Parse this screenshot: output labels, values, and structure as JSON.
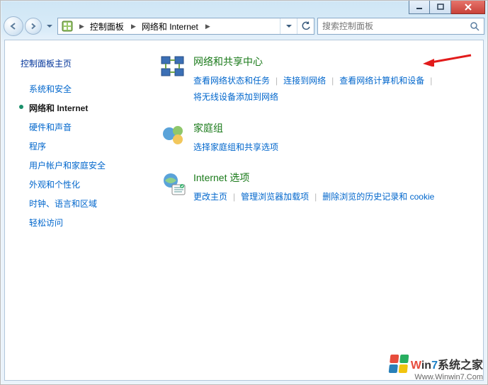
{
  "breadcrumb": {
    "items": [
      "控制面板",
      "网络和 Internet"
    ]
  },
  "search": {
    "placeholder": "搜索控制面板"
  },
  "sidebar": {
    "home": "控制面板主页",
    "items": [
      {
        "label": "系统和安全",
        "current": false
      },
      {
        "label": "网络和 Internet",
        "current": true
      },
      {
        "label": "硬件和声音",
        "current": false
      },
      {
        "label": "程序",
        "current": false
      },
      {
        "label": "用户帐户和家庭安全",
        "current": false
      },
      {
        "label": "外观和个性化",
        "current": false
      },
      {
        "label": "时钟、语言和区域",
        "current": false
      },
      {
        "label": "轻松访问",
        "current": false
      }
    ]
  },
  "sections": [
    {
      "title": "网络和共享中心",
      "links": [
        "查看网络状态和任务",
        "连接到网络",
        "查看网络计算机和设备",
        "将无线设备添加到网络"
      ]
    },
    {
      "title": "家庭组",
      "links": [
        "选择家庭组和共享选项"
      ]
    },
    {
      "title": "Internet 选项",
      "links": [
        "更改主页",
        "管理浏览器加载项",
        "删除浏览的历史记录和 cookie"
      ]
    }
  ],
  "watermark": {
    "brand_w": "W",
    "brand_in": "in",
    "brand_7": "7",
    "brand_tail": "系统之家",
    "url": "Www.Winwin7.Com"
  }
}
